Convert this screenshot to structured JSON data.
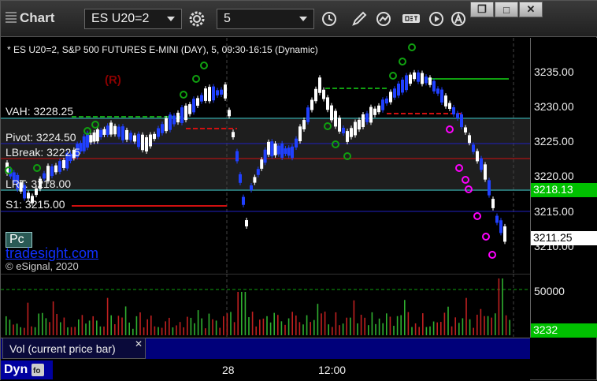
{
  "toolbar": {
    "title": "Chart",
    "symbol": "ES U20=2",
    "interval": "5",
    "window_controls": [
      "❐",
      "□",
      "✕"
    ]
  },
  "chart": {
    "header": "* ES U20=2, S&P 500 FUTURES E-MINI (DAY), 5, 09:30-16:15 (Dynamic)",
    "marker_r": "(R)",
    "labels": {
      "vah": "VAH: 3228.25",
      "pivot": "Pivot: 3224.50",
      "break": "LBreak: 3222.5",
      "lrt": "LRT: 3218.00",
      "s1": "S1: 3215.00"
    },
    "price_ticks": [
      "3235.00",
      "3230.00",
      "3225.00",
      "3220.00",
      "3215.00",
      "3210.00"
    ],
    "current_price_tag": "3218.13",
    "last_price_tag": "3211.25",
    "pc_button": "Pc",
    "watermark": "tradesight.com",
    "copyright": "© eSignal, 2020"
  },
  "volume": {
    "tick": "50000",
    "current_tag": "3232",
    "tab_label": "Vol (current price bar)",
    "close": "✕"
  },
  "time_axis": {
    "ticks": [
      "28",
      "12:00"
    ]
  },
  "status": {
    "label": "Dyn"
  },
  "colors": {
    "up": "#ffffff",
    "down": "#2040ff",
    "vah": "#30c0c0",
    "pivot": "#2020c0",
    "lbreak": "#d01010",
    "support": "#d01010",
    "green_level": "#10a010",
    "magenta": "#ff00ff",
    "tag_green": "#00c000"
  }
}
